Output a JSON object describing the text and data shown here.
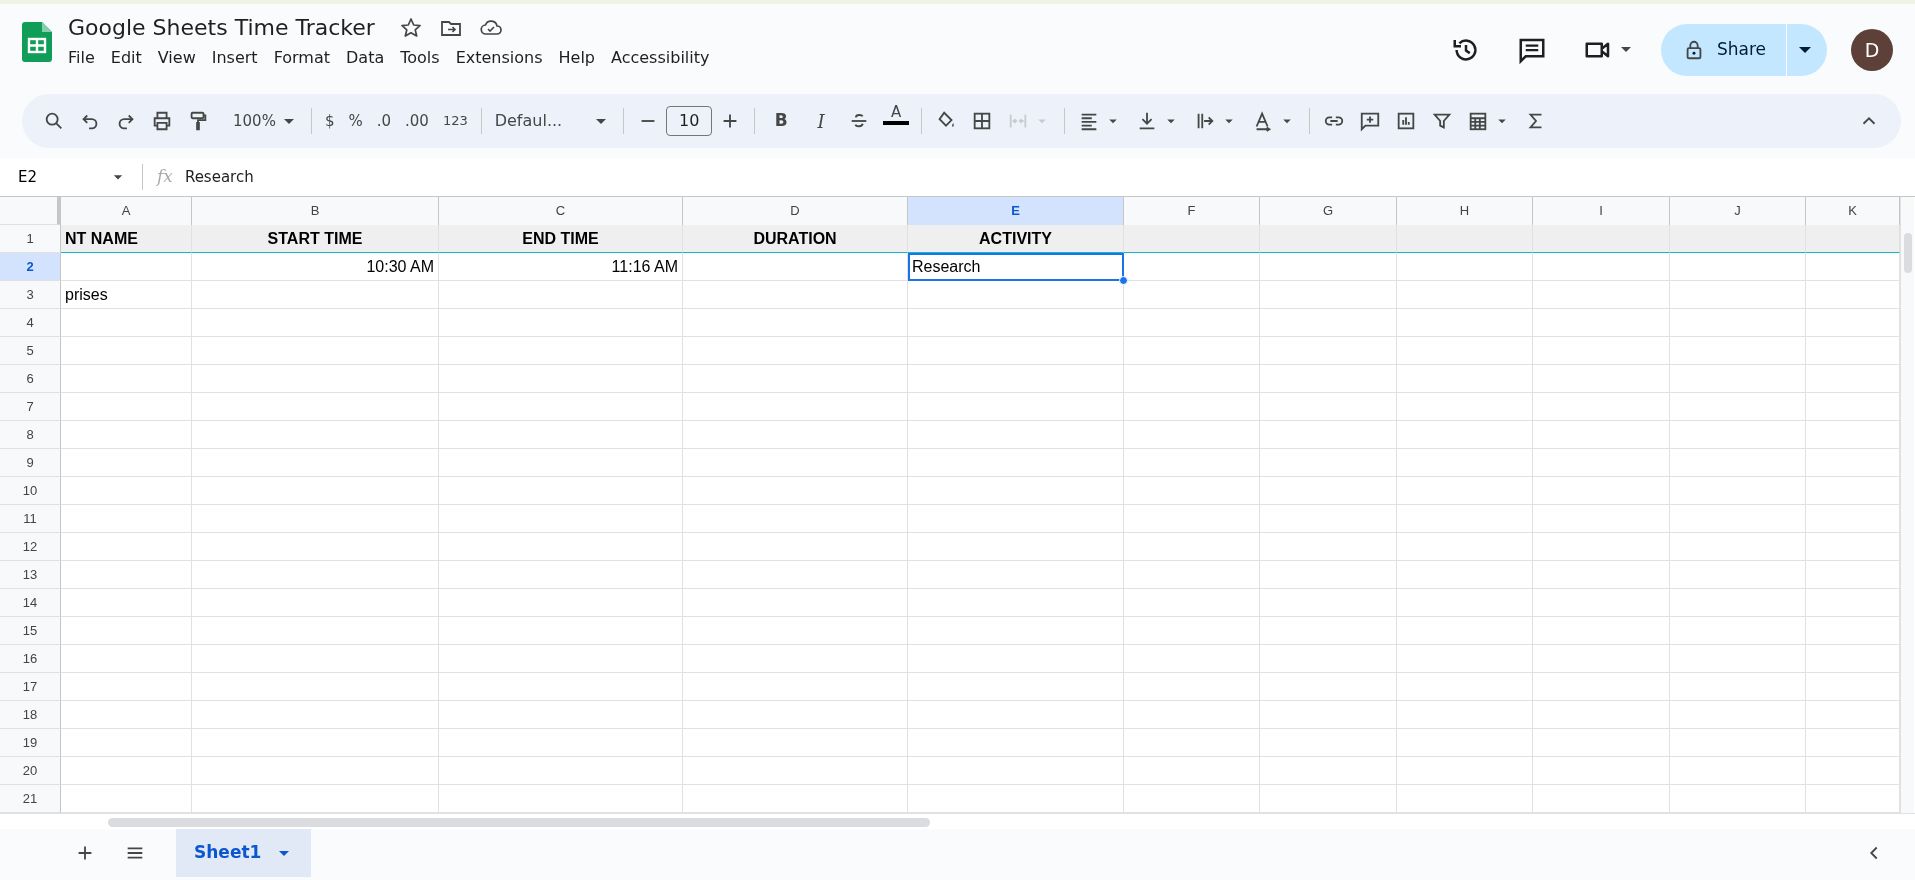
{
  "document": {
    "title": "Google Sheets Time Tracker"
  },
  "menu": [
    "File",
    "Edit",
    "View",
    "Insert",
    "Format",
    "Data",
    "Tools",
    "Extensions",
    "Help",
    "Accessibility"
  ],
  "share": {
    "label": "Share"
  },
  "avatar": {
    "initial": "D"
  },
  "toolbar": {
    "zoom": "100%",
    "currency": "$",
    "percent": "%",
    "decrease_decimal": ".0",
    "increase_decimal": ".00",
    "number_format": "123",
    "font": "Defaul...",
    "font_size": "10",
    "bold": "B",
    "italic": "I",
    "text_color": "A",
    "merge_disabled": true
  },
  "formula_bar": {
    "name_box": "E2",
    "fx": "fx",
    "value": "Research"
  },
  "columns": [
    {
      "label": "A",
      "selected": false
    },
    {
      "label": "B",
      "selected": false
    },
    {
      "label": "C",
      "selected": false
    },
    {
      "label": "D",
      "selected": false
    },
    {
      "label": "E",
      "selected": true
    },
    {
      "label": "F",
      "selected": false
    },
    {
      "label": "G",
      "selected": false
    },
    {
      "label": "H",
      "selected": false
    },
    {
      "label": "I",
      "selected": false
    },
    {
      "label": "J",
      "selected": false
    },
    {
      "label": "K",
      "selected": false
    }
  ],
  "rows": [
    {
      "label": "1",
      "selected": false,
      "kind": "header",
      "cells": {
        "a": {
          "text": "NT NAME",
          "kind": "text"
        },
        "b": {
          "text": "START TIME",
          "kind": "heading"
        },
        "c": {
          "text": "END TIME",
          "kind": "heading"
        },
        "d": {
          "text": "DURATION",
          "kind": "heading"
        },
        "e": {
          "text": "ACTIVITY",
          "kind": "heading"
        }
      }
    },
    {
      "label": "2",
      "selected": true,
      "kind": "data",
      "cells": {
        "b": {
          "text": "10:30 AM",
          "kind": "time"
        },
        "c": {
          "text": "11:16 AM",
          "kind": "time"
        },
        "e": {
          "text": "Research",
          "kind": "text"
        }
      }
    },
    {
      "label": "3",
      "selected": false,
      "kind": "data",
      "cells": {
        "a": {
          "text": "prises",
          "kind": "text"
        }
      }
    },
    {
      "label": "4",
      "selected": false,
      "kind": "data"
    },
    {
      "label": "5",
      "selected": false,
      "kind": "data"
    },
    {
      "label": "6",
      "selected": false,
      "kind": "data"
    },
    {
      "label": "7",
      "selected": false,
      "kind": "data"
    },
    {
      "label": "8",
      "selected": false,
      "kind": "data"
    },
    {
      "label": "9",
      "selected": false,
      "kind": "data"
    },
    {
      "label": "10",
      "selected": false,
      "kind": "data"
    },
    {
      "label": "11",
      "selected": false,
      "kind": "data"
    },
    {
      "label": "12",
      "selected": false,
      "kind": "data"
    },
    {
      "label": "13",
      "selected": false,
      "kind": "data"
    },
    {
      "label": "14",
      "selected": false,
      "kind": "data"
    },
    {
      "label": "15",
      "selected": false,
      "kind": "data"
    },
    {
      "label": "16",
      "selected": false,
      "kind": "data"
    },
    {
      "label": "17",
      "selected": false,
      "kind": "data"
    },
    {
      "label": "18",
      "selected": false,
      "kind": "data"
    },
    {
      "label": "19",
      "selected": false,
      "kind": "data"
    },
    {
      "label": "20",
      "selected": false,
      "kind": "data"
    },
    {
      "label": "21",
      "selected": false,
      "kind": "data"
    }
  ],
  "sheets": [
    {
      "label": "Sheet1",
      "selected": true
    }
  ]
}
